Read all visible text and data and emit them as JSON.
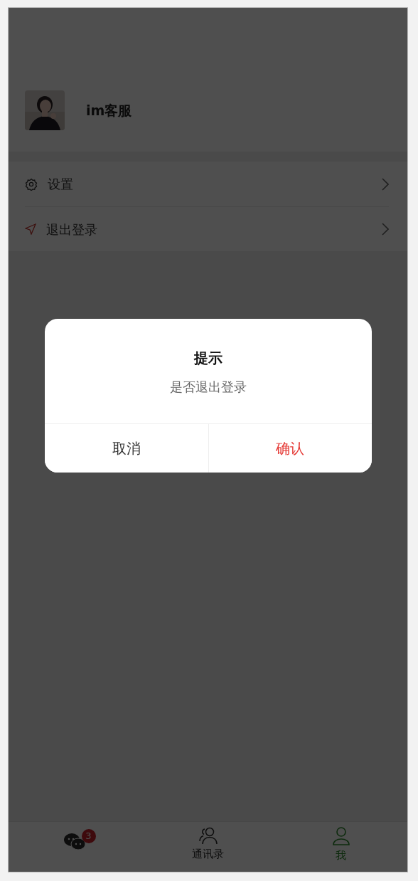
{
  "profile": {
    "name": "im客服"
  },
  "menu": [
    {
      "label": "设置",
      "kind": "gear"
    },
    {
      "label": "退出登录",
      "kind": "send"
    }
  ],
  "dialog": {
    "title": "提示",
    "message": "是否退出登录",
    "buttons": [
      {
        "label": "取消",
        "kind": "cancel"
      },
      {
        "label": "确认",
        "kind": "confirm"
      }
    ]
  },
  "tabs": [
    {
      "badge": "3",
      "kind": "chat",
      "selected": false
    },
    {
      "label": "通讯录",
      "kind": "contacts",
      "selected": false
    },
    {
      "label": "我",
      "kind": "person",
      "selected": true
    }
  ]
}
